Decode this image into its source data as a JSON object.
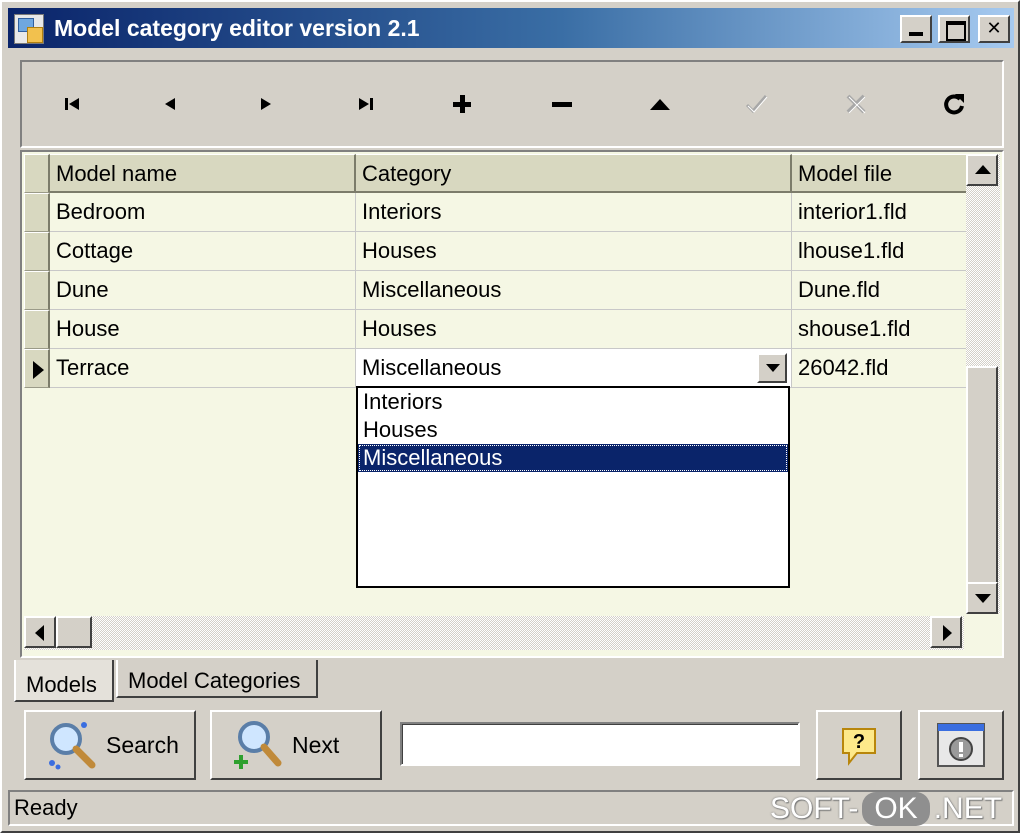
{
  "window": {
    "title": "Model category editor version 2.1",
    "icon": "app-icon",
    "controls": [
      "minimize-icon",
      "maximize-icon",
      "close-icon"
    ],
    "close_glyph": "✕"
  },
  "toolbar": {
    "buttons": [
      {
        "name": "first-record",
        "icon": "first-icon",
        "enabled": true
      },
      {
        "name": "prior-record",
        "icon": "prior-icon",
        "enabled": true
      },
      {
        "name": "next-record",
        "icon": "next-icon",
        "enabled": true
      },
      {
        "name": "last-record",
        "icon": "last-icon",
        "enabled": true
      },
      {
        "name": "insert-record",
        "icon": "plus-icon",
        "enabled": true
      },
      {
        "name": "delete-record",
        "icon": "minus-icon",
        "enabled": true
      },
      {
        "name": "edit-record",
        "icon": "up-triangle-icon",
        "enabled": true
      },
      {
        "name": "post-edit",
        "icon": "check-icon",
        "enabled": false
      },
      {
        "name": "cancel-edit",
        "icon": "x-icon",
        "enabled": false
      },
      {
        "name": "refresh-data",
        "icon": "refresh-icon",
        "enabled": true
      }
    ]
  },
  "grid": {
    "columns": [
      "Model name",
      "Category",
      "Model file"
    ],
    "rows": [
      {
        "name": "Bedroom",
        "category": "Interiors",
        "file": "interior1.fld"
      },
      {
        "name": "Cottage",
        "category": "Houses",
        "file": "lhouse1.fld"
      },
      {
        "name": "Dune",
        "category": "Miscellaneous",
        "file": "Dune.fld"
      },
      {
        "name": "House",
        "category": "Houses",
        "file": "shouse1.fld"
      },
      {
        "name": "Terrace",
        "category": "Miscellaneous",
        "file": "26042.fld"
      }
    ],
    "current_row_index": 4,
    "dropdown": {
      "options": [
        "Interiors",
        "Houses",
        "Miscellaneous"
      ],
      "selected": "Miscellaneous"
    }
  },
  "tabs": [
    {
      "label": "Models",
      "active": true
    },
    {
      "label": "Model Categories",
      "active": false
    }
  ],
  "bottom": {
    "search_label": "Search",
    "next_label": "Next",
    "search_value": ""
  },
  "status": {
    "text": "Ready"
  },
  "watermark": {
    "left": "SOFT-",
    "middle": "OK",
    "right": ".NET"
  },
  "colors": {
    "title_gradient_start": "#0a246a",
    "grid_background": "#f5f7e4",
    "header_background": "#d8d8c0",
    "selection": "#0a246a"
  }
}
